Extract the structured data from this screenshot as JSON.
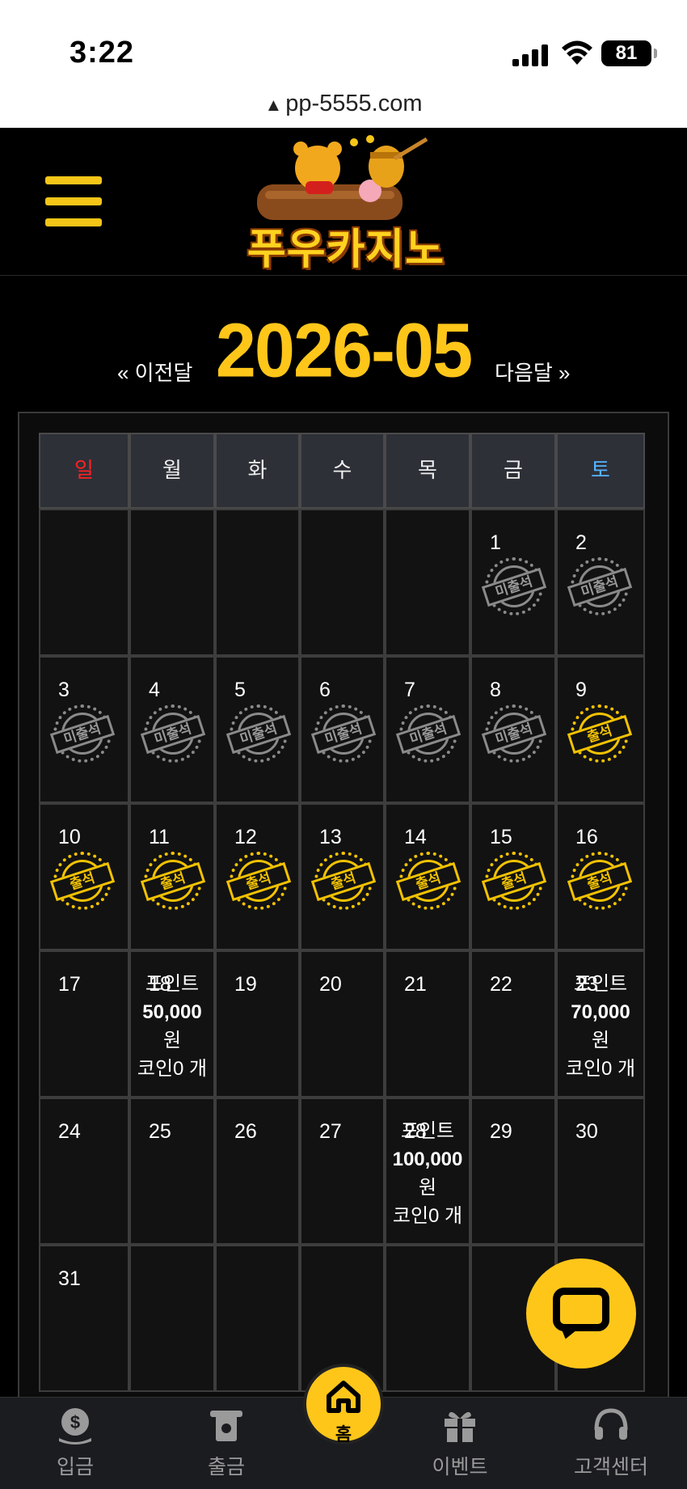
{
  "status_bar": {
    "time": "3:22",
    "battery": "81"
  },
  "url_bar": {
    "url": "pp-5555.com"
  },
  "header": {
    "logo_text": "푸우카지노"
  },
  "month_nav": {
    "prev_label": "« 이전달",
    "title": "2026-05",
    "next_label": "다음달 »"
  },
  "calendar": {
    "weekdays": [
      "일",
      "월",
      "화",
      "수",
      "목",
      "금",
      "토"
    ],
    "absent_label": "미출석",
    "present_label": "출석",
    "weeks": [
      [
        {
          "day": ""
        },
        {
          "day": ""
        },
        {
          "day": ""
        },
        {
          "day": ""
        },
        {
          "day": ""
        },
        {
          "day": "1",
          "status": "absent"
        },
        {
          "day": "2",
          "status": "absent"
        }
      ],
      [
        {
          "day": "3",
          "status": "absent"
        },
        {
          "day": "4",
          "status": "absent"
        },
        {
          "day": "5",
          "status": "absent"
        },
        {
          "day": "6",
          "status": "absent"
        },
        {
          "day": "7",
          "status": "absent"
        },
        {
          "day": "8",
          "status": "absent"
        },
        {
          "day": "9",
          "status": "present"
        }
      ],
      [
        {
          "day": "10",
          "status": "present"
        },
        {
          "day": "11",
          "status": "present"
        },
        {
          "day": "12",
          "status": "present"
        },
        {
          "day": "13",
          "status": "present"
        },
        {
          "day": "14",
          "status": "present"
        },
        {
          "day": "15",
          "status": "present"
        },
        {
          "day": "16",
          "status": "present"
        }
      ],
      [
        {
          "day": "17"
        },
        {
          "day": "18",
          "reward": {
            "label": "포인트",
            "amount": "50,000",
            "unit": "원",
            "coin": "코인0 개"
          }
        },
        {
          "day": "19"
        },
        {
          "day": "20"
        },
        {
          "day": "21"
        },
        {
          "day": "22"
        },
        {
          "day": "23",
          "reward": {
            "label": "포인트",
            "amount": "70,000",
            "unit": "원",
            "coin": "코인0 개"
          }
        }
      ],
      [
        {
          "day": "24"
        },
        {
          "day": "25"
        },
        {
          "day": "26"
        },
        {
          "day": "27"
        },
        {
          "day": "28",
          "reward": {
            "label": "포인트",
            "amount": "100,000",
            "unit": "원",
            "coin": "코인0 개"
          }
        },
        {
          "day": "29"
        },
        {
          "day": "30"
        }
      ],
      [
        {
          "day": "31"
        },
        {
          "day": ""
        },
        {
          "day": ""
        },
        {
          "day": ""
        },
        {
          "day": ""
        },
        {
          "day": ""
        },
        {
          "day": ""
        }
      ]
    ]
  },
  "bottom_nav": {
    "deposit": "입금",
    "withdraw": "출금",
    "home": "홈",
    "event": "이벤트",
    "support": "고객센터"
  },
  "colors": {
    "accent": "#ffc61a",
    "sunday": "#ff2222",
    "saturday": "#56b4ff"
  }
}
